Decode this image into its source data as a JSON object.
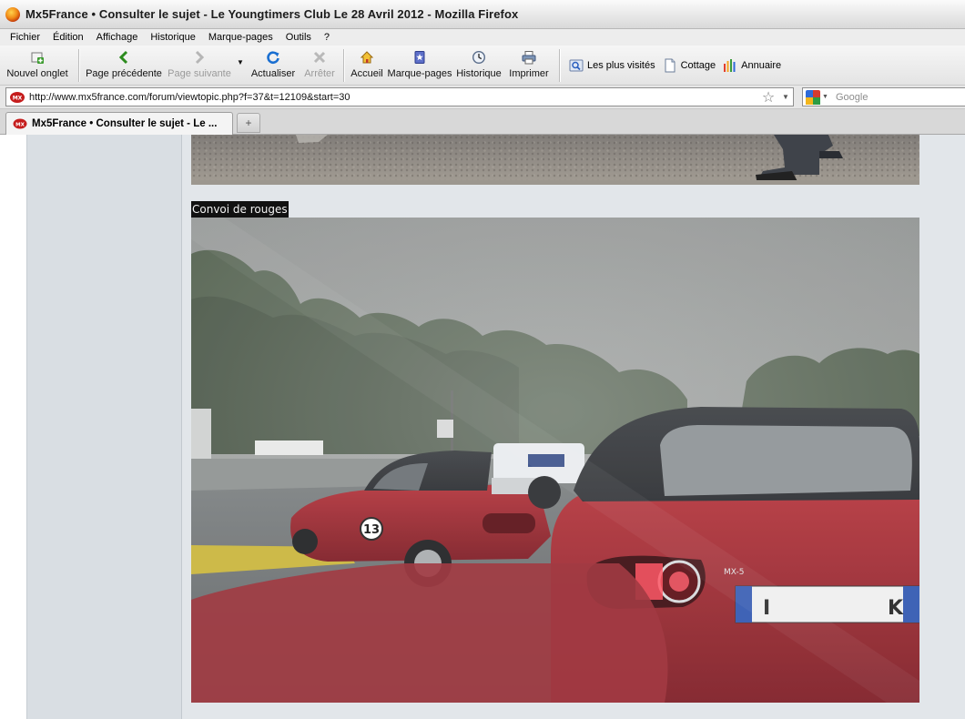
{
  "window": {
    "title": "Mx5France • Consulter le sujet - Le Youngtimers Club Le 28 Avril 2012 - Mozilla Firefox"
  },
  "menu": {
    "items": [
      {
        "label": "Fichier"
      },
      {
        "label": "Édition"
      },
      {
        "label": "Affichage"
      },
      {
        "label": "Historique"
      },
      {
        "label": "Marque-pages"
      },
      {
        "label": "Outils"
      },
      {
        "label": "?"
      }
    ]
  },
  "toolbar": {
    "new_tab": "Nouvel onglet",
    "back": "Page précédente",
    "forward": "Page suivante",
    "reload": "Actualiser",
    "stop": "Arrêter",
    "home": "Accueil",
    "bookmarks": "Marque-pages",
    "history": "Historique",
    "print": "Imprimer",
    "links": [
      {
        "label": "Les plus visités",
        "icon": "magnifier-icon"
      },
      {
        "label": "Cottage",
        "icon": "page-icon"
      },
      {
        "label": "Annuaire",
        "icon": "bars-icon"
      }
    ]
  },
  "address": {
    "url": "http://www.mx5france.com/forum/viewtopic.php?f=37&t=12109&start=30",
    "search_placeholder": "Google"
  },
  "tabs": [
    {
      "label": "Mx5France • Consulter le sujet - Le ...",
      "active": true
    }
  ],
  "new_tab_glyph": "+",
  "post": {
    "caption": "Convoi de rouges"
  }
}
